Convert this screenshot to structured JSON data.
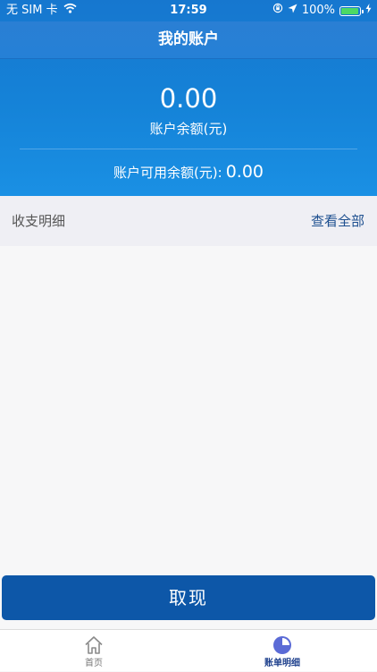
{
  "status_bar": {
    "carrier": "无 SIM 卡",
    "time": "17:59",
    "battery": "100%"
  },
  "nav": {
    "title": "我的账户"
  },
  "account": {
    "balance_value": "0.00",
    "balance_label": "账户余额(元)",
    "available_label": "账户可用余额(元):",
    "available_value": "0.00"
  },
  "section": {
    "title": "收支明细",
    "view_all": "查看全部"
  },
  "actions": {
    "withdraw": "取现"
  },
  "tabbar": {
    "home": "首页",
    "bill": "账单明细"
  },
  "colors": {
    "header_blue": "#1583d8",
    "button_blue": "#0d57a8",
    "active_tab": "#1d3f8c",
    "link": "#1d4f8f"
  }
}
